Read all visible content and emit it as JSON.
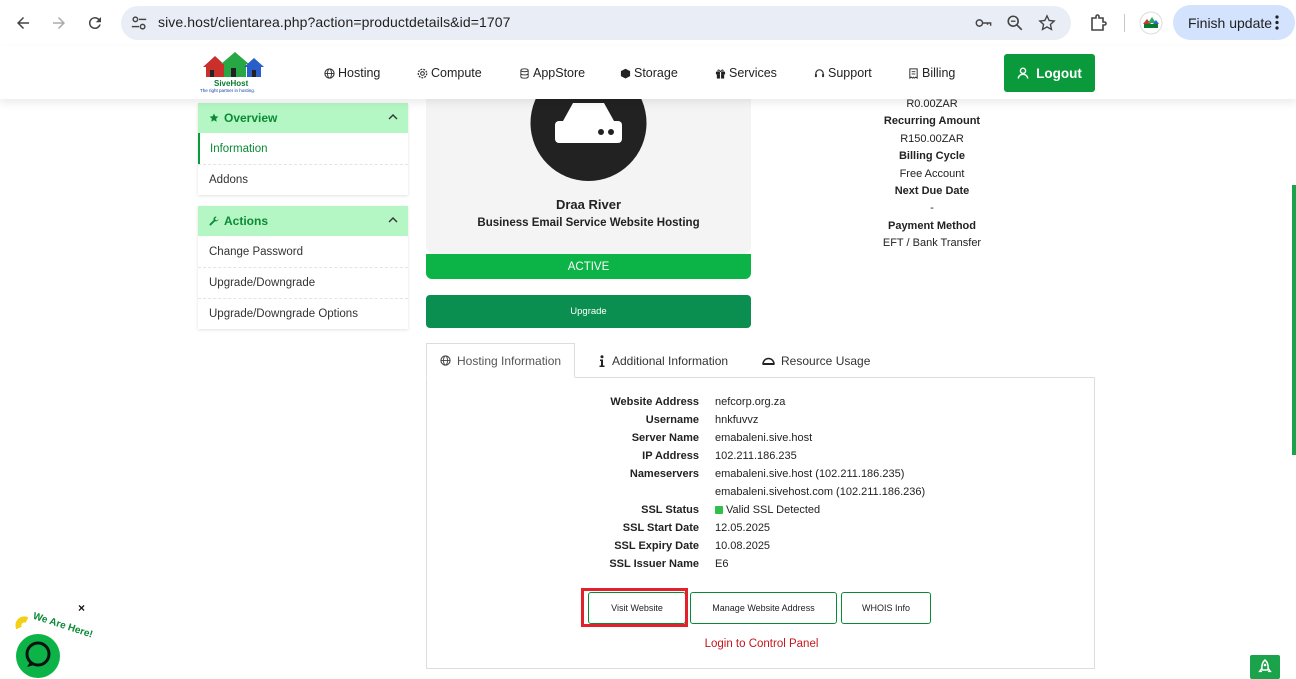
{
  "browser": {
    "url": "sive.host/clientarea.php?action=productdetails&id=1707",
    "finish_update_label": "Finish update"
  },
  "header": {
    "logo_brand": "SiveHost",
    "logo_tagline": "The right partner in hosting.",
    "menu": [
      {
        "label": "Hosting",
        "icon": "globe-icon"
      },
      {
        "label": "Compute",
        "icon": "gear-icon"
      },
      {
        "label": "AppStore",
        "icon": "database-icon"
      },
      {
        "label": "Storage",
        "icon": "box-icon"
      },
      {
        "label": "Services",
        "icon": "gift-icon"
      },
      {
        "label": "Support",
        "icon": "headset-icon"
      },
      {
        "label": "Billing",
        "icon": "receipt-icon"
      }
    ],
    "logout_label": "Logout",
    "accent_color": "#0b9a3b"
  },
  "sidebar": {
    "overview": {
      "title": "Overview",
      "items": [
        {
          "label": "Information",
          "active": true
        },
        {
          "label": "Addons",
          "active": false
        }
      ]
    },
    "actions": {
      "title": "Actions",
      "items": [
        {
          "label": "Change Password"
        },
        {
          "label": "Upgrade/Downgrade"
        },
        {
          "label": "Upgrade/Downgrade Options"
        }
      ]
    }
  },
  "product": {
    "name": "Draa River",
    "group": "Business Email Service Website Hosting",
    "status": "ACTIVE",
    "upgrade_label": "Upgrade"
  },
  "billing": {
    "first_payment_value": "R0.00ZAR",
    "recurring_label": "Recurring Amount",
    "recurring_value": "R150.00ZAR",
    "cycle_label": "Billing Cycle",
    "cycle_value": "Free Account",
    "due_label": "Next Due Date",
    "due_value": "-",
    "method_label": "Payment Method",
    "method_value": "EFT / Bank Transfer"
  },
  "tabs": [
    {
      "label": "Hosting Information",
      "active": true
    },
    {
      "label": "Additional Information",
      "active": false
    },
    {
      "label": "Resource Usage",
      "active": false
    }
  ],
  "hosting_info": {
    "rows": [
      {
        "key": "Website Address",
        "value": "nefcorp.org.za"
      },
      {
        "key": "Username",
        "value": "hnkfuvvz"
      },
      {
        "key": "Server Name",
        "value": "emabaleni.sive.host"
      },
      {
        "key": "IP Address",
        "value": "102.211.186.235"
      },
      {
        "key": "Nameservers",
        "value": "emabaleni.sive.host (102.211.186.235)"
      },
      {
        "key": "",
        "value": "emabaleni.sivehost.com (102.211.186.236)"
      },
      {
        "key": "SSL Status",
        "value": "Valid SSL Detected"
      },
      {
        "key": "SSL Start Date",
        "value": "12.05.2025"
      },
      {
        "key": "SSL Expiry Date",
        "value": "10.08.2025"
      },
      {
        "key": "SSL Issuer Name",
        "value": "E6"
      }
    ],
    "buttons": {
      "visit": "Visit Website",
      "manage": "Manage Website Address",
      "whois": "WHOIS Info"
    },
    "cpanel_link": "Login to Control Panel"
  },
  "chat": {
    "badge_text": "We Are Here!",
    "close": "×"
  }
}
